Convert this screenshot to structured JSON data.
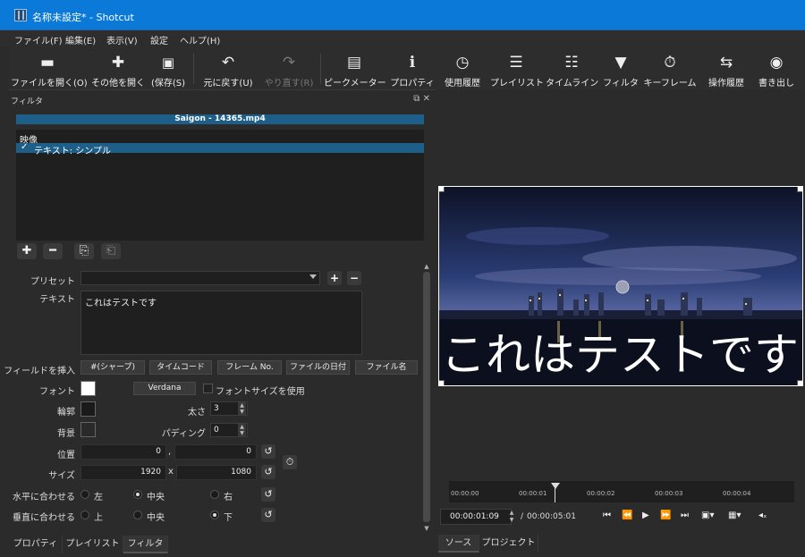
{
  "window": {
    "title": "名称未設定* - Shotcut"
  },
  "menu": [
    "ファイル(F)",
    "編集(E)",
    "表示(V)",
    "設定",
    "ヘルプ(H)"
  ],
  "toolbar": [
    {
      "label": "ファイルを開く(O)",
      "icon": "folder-open-icon",
      "glyph": "▬",
      "enabled": true
    },
    {
      "label": "その他を開く",
      "icon": "open-other-icon",
      "glyph": "✚",
      "enabled": true
    },
    {
      "label": "(保存(S)",
      "icon": "save-icon",
      "glyph": "💾",
      "enabled": true
    },
    {
      "label": "元に戻す(U)",
      "icon": "undo-icon",
      "glyph": "↶",
      "enabled": true
    },
    {
      "label": "やり直す(R)",
      "icon": "redo-icon",
      "glyph": "↷",
      "enabled": false
    },
    {
      "label": "ピークメーター",
      "icon": "peak-meter-icon",
      "glyph": "▤",
      "enabled": true
    },
    {
      "label": "プロパティ",
      "icon": "info-icon",
      "glyph": "ℹ",
      "enabled": true
    },
    {
      "label": "使用履歴",
      "icon": "clock-icon",
      "glyph": "◷",
      "enabled": true
    },
    {
      "label": "プレイリスト",
      "icon": "playlist-icon",
      "glyph": "☰",
      "enabled": true
    },
    {
      "label": "タイムライン",
      "icon": "timeline-icon",
      "glyph": "☷",
      "enabled": true
    },
    {
      "label": "フィルタ",
      "icon": "filter-icon",
      "glyph": "▼",
      "enabled": true
    },
    {
      "label": "キーフレーム",
      "icon": "stopwatch-icon",
      "glyph": "⏱",
      "enabled": true
    },
    {
      "label": "操作履歴",
      "icon": "history-icon",
      "glyph": "⇆",
      "enabled": true
    },
    {
      "label": "書き出し",
      "icon": "export-disc-icon",
      "glyph": "◉",
      "enabled": true
    }
  ],
  "filters_panel": {
    "title": "フィルタ",
    "clip_name": "Saigon - 14365.mp4",
    "list_header": "映像",
    "items": [
      {
        "label": "テキスト: シンプル",
        "checked": true
      }
    ],
    "check_glyph": "✓",
    "list_buttons": {
      "add": "✚",
      "remove": "━",
      "copy": "⎘",
      "paste": "⎗"
    }
  },
  "form": {
    "preset_label": "プリセット",
    "preset_value": "",
    "text_label": "テキスト",
    "text_value": "これはテストです",
    "insert_field_label": "フィールドを挿入",
    "insert_buttons": [
      "#(シャープ)",
      "タイムコード",
      "フレーム No.",
      "ファイルの日付",
      "ファイル名"
    ],
    "font_label": "フォント",
    "font_button": "Verdana",
    "use_font_size_label": "フォントサイズを使用",
    "outline_label": "輪郭",
    "thickness_label": "太さ",
    "thickness_value": "3",
    "background_label": "背景",
    "padding_label": "パディング",
    "padding_value": "0",
    "position_label": "位置",
    "position_x": "0",
    "position_sep": ",",
    "position_y": "0",
    "size_label": "サイズ",
    "size_w": "1920",
    "size_sep": "x",
    "size_h": "1080",
    "halign_label": "水平に合わせる",
    "halign_options": [
      "左",
      "中央",
      "右"
    ],
    "halign_selected": "中央",
    "valign_label": "垂直に合わせる",
    "valign_options": [
      "上",
      "中央",
      "下"
    ],
    "valign_selected": "下",
    "font_color": "#ffffff",
    "outline_color": "#1a1a1a",
    "bg_color": "#2a2a2a"
  },
  "left_tabs": [
    "プロパティ",
    "プレイリスト",
    "フィルタ"
  ],
  "left_active_tab": "フィルタ",
  "player": {
    "overlay_text": "これはテストです",
    "ruler_ticks": [
      "00:00:00",
      "00:00:01",
      "00:00:02",
      "00:00:03",
      "00:00:04"
    ],
    "current_time": "00:00:01:09",
    "total_time": "00:00:05:01",
    "time_separator": "/",
    "tabs": [
      "ソース",
      "プロジェクト"
    ],
    "active_tab": "ソース"
  },
  "colors": {
    "titlebar": "#0a79d8",
    "selection": "#1e5f8a",
    "panel": "#2b2b2b"
  }
}
